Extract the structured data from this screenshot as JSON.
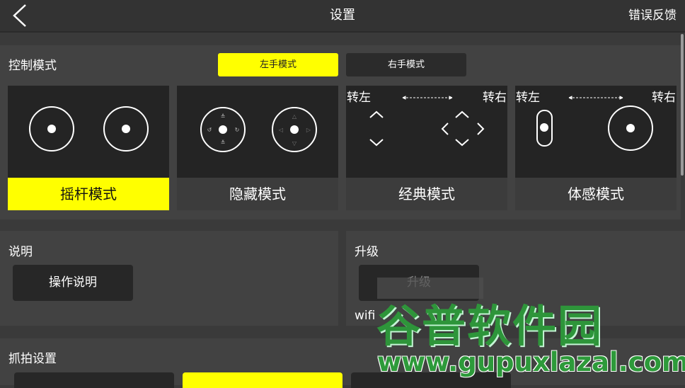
{
  "header": {
    "title": "设置",
    "feedback_label": "错误反馈"
  },
  "control": {
    "section_title": "控制模式",
    "tab_left": "左手模式",
    "tab_right": "右手模式",
    "turn_left": "转左",
    "turn_right": "转右",
    "modes": [
      {
        "label": "摇杆模式",
        "active": true
      },
      {
        "label": "隐藏模式",
        "active": false
      },
      {
        "label": "经典模式",
        "active": false
      },
      {
        "label": "体感模式",
        "active": false
      }
    ]
  },
  "help": {
    "section_title": "说明",
    "button_label": "操作说明"
  },
  "upgrade": {
    "section_title": "升级",
    "button_label": "升级",
    "wifi_text": "wifi"
  },
  "capture": {
    "section_title": "抓拍设置"
  },
  "watermark": {
    "brand": "谷普软件园",
    "url": "www.gupuxlazal.com"
  },
  "colors": {
    "accent": "#ffff00",
    "background": "#3a3a3a",
    "card": "#242424"
  }
}
